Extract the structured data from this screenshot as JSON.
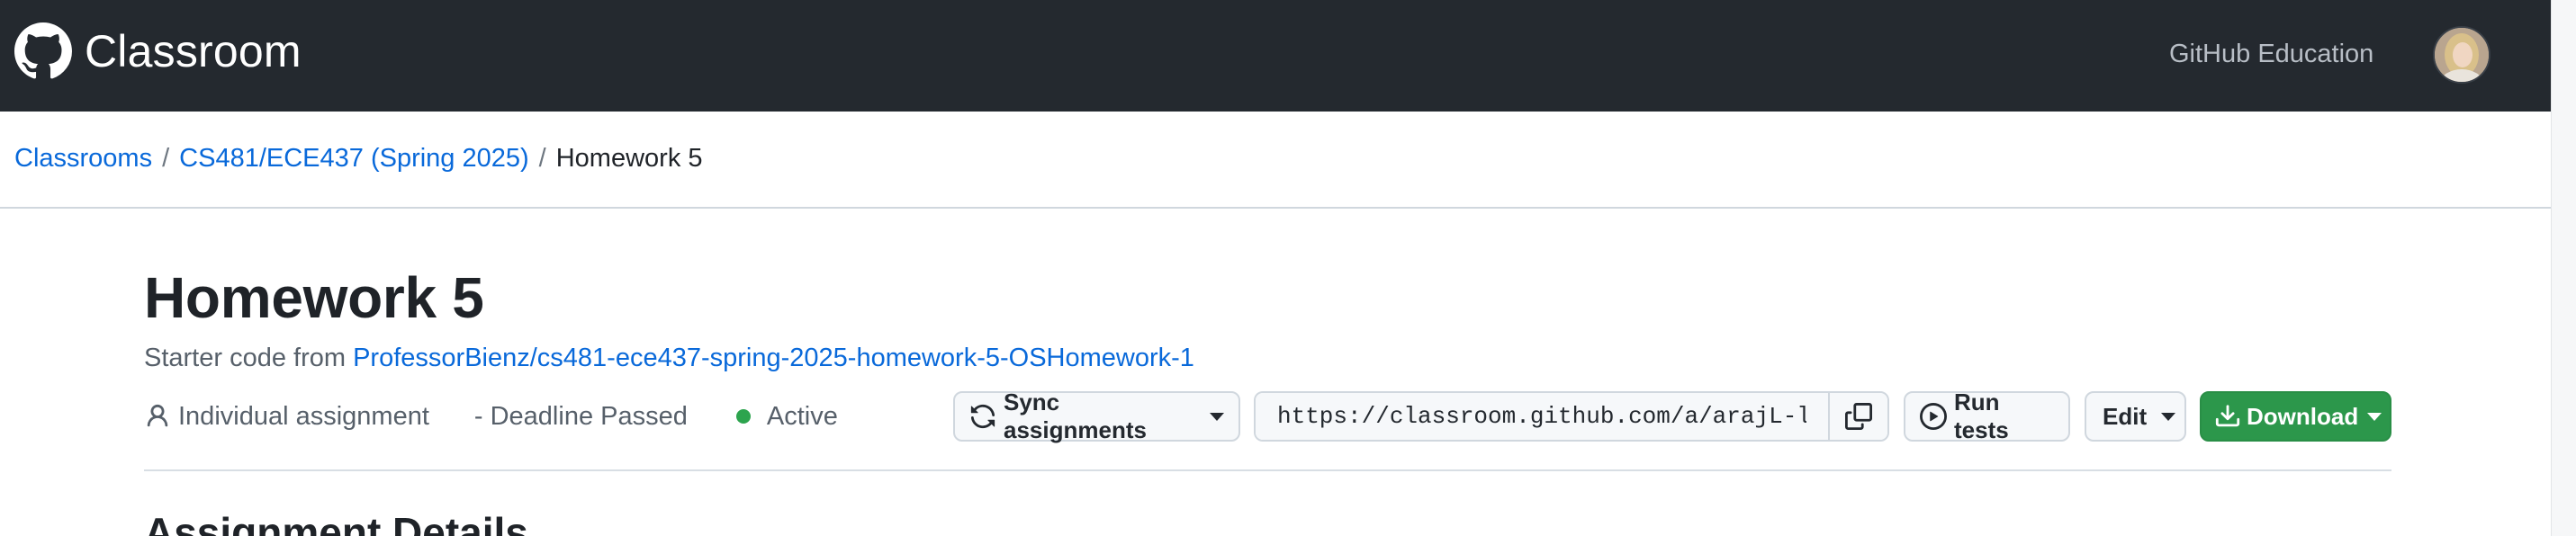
{
  "header": {
    "app_title": "Classroom",
    "education_link": "GitHub Education",
    "logo_icon": "github-octocat-icon",
    "avatar_icon": "user-avatar"
  },
  "breadcrumb": {
    "items": [
      {
        "label": "Classrooms"
      },
      {
        "label": "CS481/ECE437 (Spring 2025)"
      }
    ],
    "separator": "/",
    "current": "Homework 5"
  },
  "assignment": {
    "title": "Homework 5",
    "starter_prefix": "Starter code from",
    "starter_repo": "ProfessorBienz/cs481-ece437-spring-2025-homework-5-OSHomework-1",
    "type_label": "Individual assignment",
    "deadline_label": "- Deadline Passed",
    "status_label": "Active",
    "status_color": "#2da44e"
  },
  "actions": {
    "sync_label": "Sync assignments",
    "invite_url": "https://classroom.github.com/a/arajL-lB",
    "run_tests_label": "Run tests",
    "edit_label": "Edit",
    "download_label": "Download",
    "download_color": "#2c974b"
  },
  "section": {
    "details_title": "Assignment Details"
  },
  "colors": {
    "header_bg": "#24292f",
    "link": "#0969da"
  }
}
